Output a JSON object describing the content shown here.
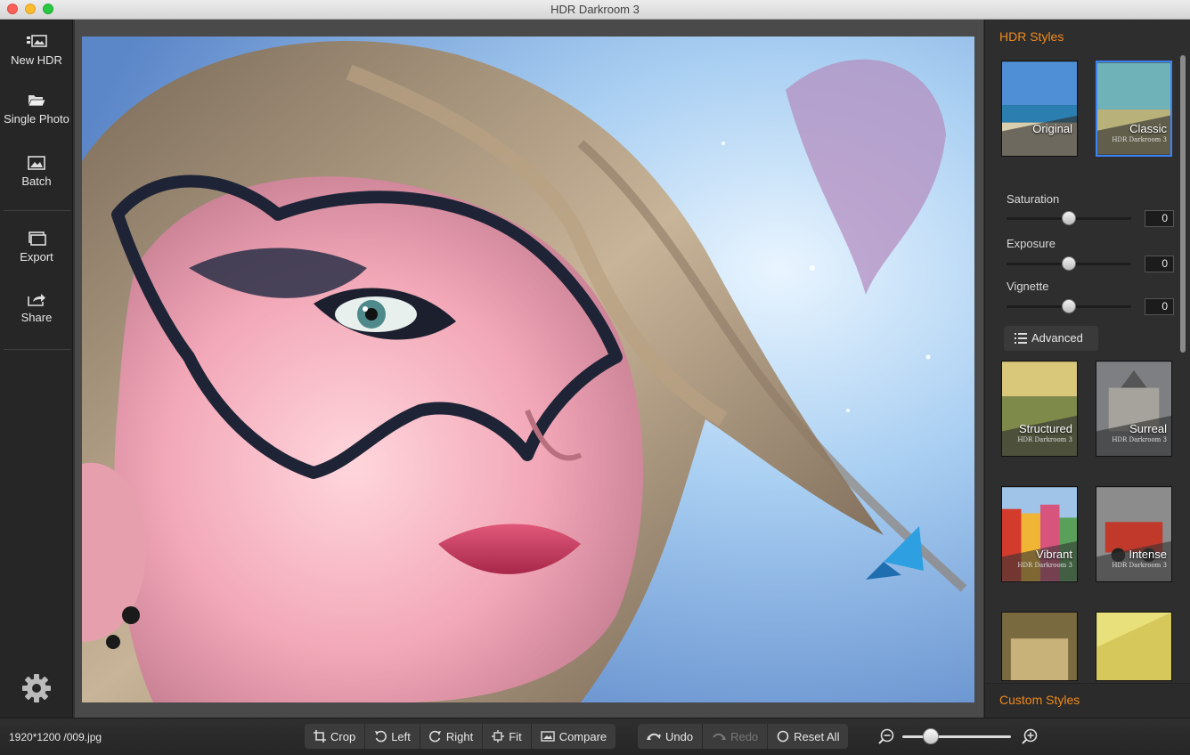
{
  "window": {
    "title": "HDR Darkroom 3"
  },
  "sidebar": {
    "items": [
      {
        "label": "New HDR",
        "icon": "new-hdr-icon"
      },
      {
        "label": "Single Photo",
        "icon": "folder-open-icon"
      },
      {
        "label": "Batch",
        "icon": "batch-icon"
      },
      {
        "label": "Export",
        "icon": "export-icon"
      },
      {
        "label": "Share",
        "icon": "share-icon"
      }
    ],
    "settings_icon": "gear-icon"
  },
  "panel": {
    "title": "HDR Styles",
    "top_styles": [
      {
        "label": "Original",
        "sub": "",
        "selected": false
      },
      {
        "label": "Classic",
        "sub": "HDR Darkroom 3",
        "selected": true
      }
    ],
    "sliders": [
      {
        "label": "Saturation",
        "value": "0"
      },
      {
        "label": "Exposure",
        "value": "0"
      },
      {
        "label": "Vignette",
        "value": "0"
      }
    ],
    "advanced_label": "Advanced",
    "styles": [
      {
        "label": "Structured",
        "sub": "HDR Darkroom 3"
      },
      {
        "label": "Surreal",
        "sub": "HDR Darkroom 3"
      },
      {
        "label": "Vibrant",
        "sub": "HDR Darkroom 3"
      },
      {
        "label": "Intense",
        "sub": "HDR Darkroom 3"
      }
    ],
    "custom_styles": "Custom Styles"
  },
  "bottombar": {
    "file_info": "1920*1200 /009.jpg",
    "tools": {
      "crop": "Crop",
      "left": "Left",
      "right": "Right",
      "fit": "Fit",
      "compare": "Compare"
    },
    "history": {
      "undo": "Undo",
      "redo": "Redo",
      "reset": "Reset All"
    },
    "zoom_level": 0.27
  },
  "colors": {
    "accent": "#f08a1c",
    "selection": "#3b82f6"
  }
}
